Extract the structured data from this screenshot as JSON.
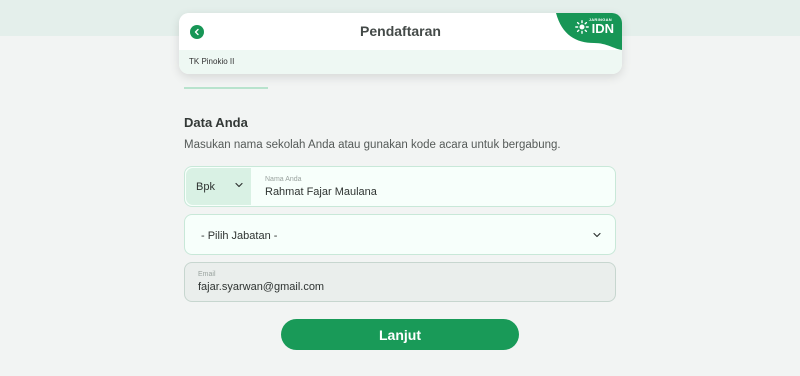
{
  "header": {
    "title": "Pendaftaran",
    "subtitle": "TK Pinokio II",
    "brand": {
      "small_text": "JARINGAN",
      "name": "IDN"
    }
  },
  "section": {
    "title": "Data Anda",
    "description": "Masukan nama sekolah Anda atau gunakan kode acara untuk bergabung."
  },
  "form": {
    "salutation": "Bpk",
    "name_label": "Nama Anda",
    "name_value": "Rahmat Fajar Maulana",
    "position_placeholder": "- Pilih Jabatan -",
    "email_label": "Email",
    "email_value": "fajar.syarwan@gmail.com",
    "submit_label": "Lanjut"
  },
  "colors": {
    "primary": "#199a58",
    "field_border": "#c8e8d8",
    "field_bg": "#f7fffb"
  },
  "icons": [
    "back-arrow-icon",
    "brand-logo-icon",
    "chevron-down-icon"
  ]
}
